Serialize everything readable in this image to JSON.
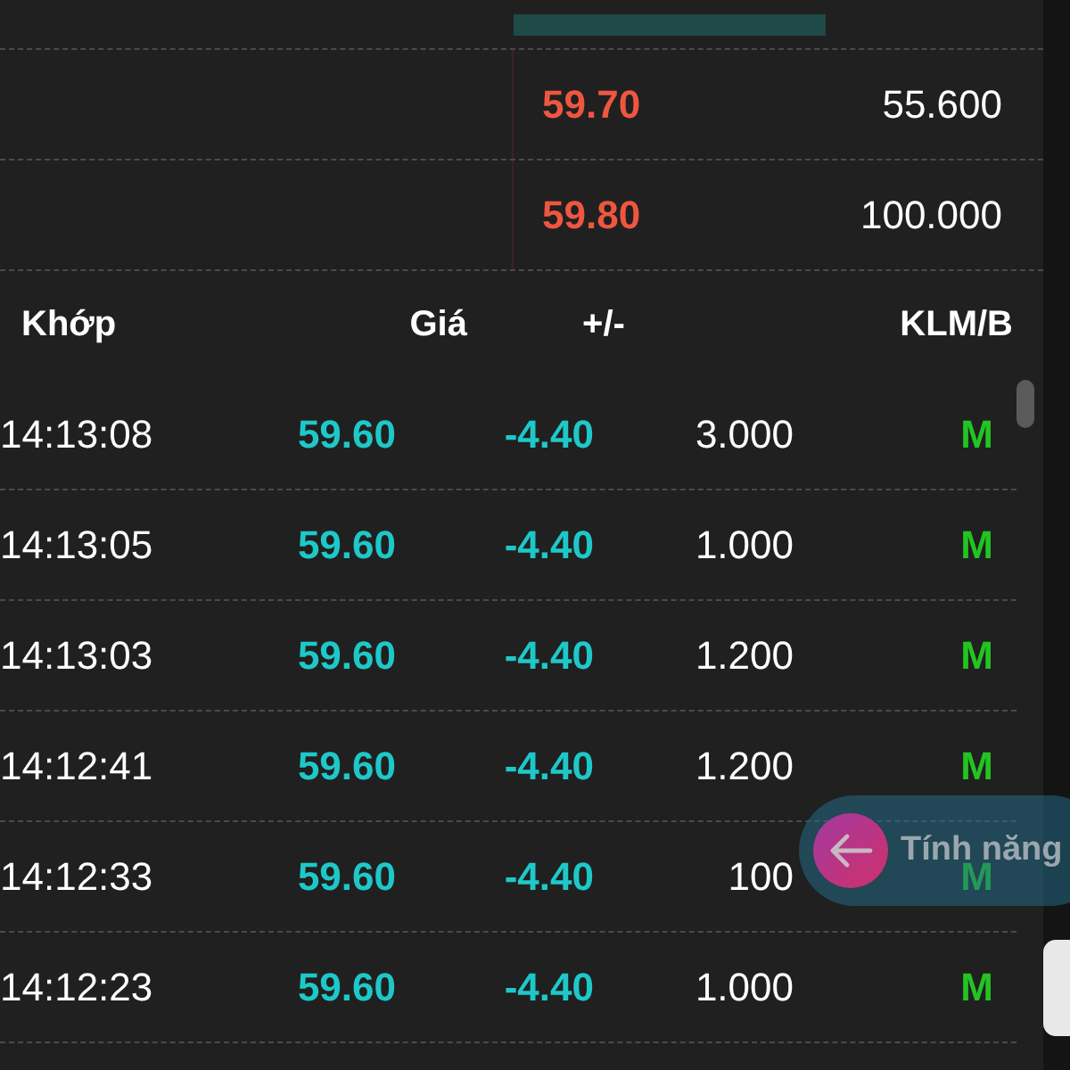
{
  "depth_bar": {
    "level": 0.64
  },
  "order_book": [
    {
      "price": "59.70",
      "volume": "55.600"
    },
    {
      "price": "59.80",
      "volume": "100.000"
    }
  ],
  "trades": {
    "columns": [
      "Khớp",
      "Giá",
      "+/-",
      "KLM/B"
    ],
    "rows": [
      {
        "time": "14:13:08",
        "price": "59.60",
        "change": "-4.40",
        "volume": "3.000",
        "side": "M"
      },
      {
        "time": "14:13:05",
        "price": "59.60",
        "change": "-4.40",
        "volume": "1.000",
        "side": "M"
      },
      {
        "time": "14:13:03",
        "price": "59.60",
        "change": "-4.40",
        "volume": "1.200",
        "side": "M"
      },
      {
        "time": "14:12:41",
        "price": "59.60",
        "change": "-4.40",
        "volume": "1.200",
        "side": "M"
      },
      {
        "time": "14:12:33",
        "price": "59.60",
        "change": "-4.40",
        "volume": "100",
        "side": "M"
      },
      {
        "time": "14:12:23",
        "price": "59.60",
        "change": "-4.40",
        "volume": "1.000",
        "side": "M"
      }
    ]
  },
  "feature_pill": {
    "label": "Tính năng"
  }
}
